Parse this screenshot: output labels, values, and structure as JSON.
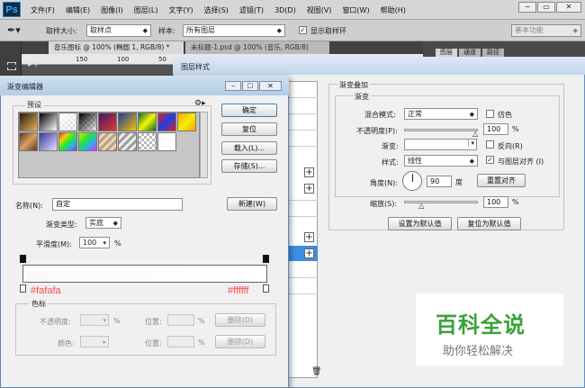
{
  "app": {
    "logo": "Ps"
  },
  "menubar": [
    "文件(F)",
    "编辑(E)",
    "图像(I)",
    "图层(L)",
    "文字(Y)",
    "选择(S)",
    "滤镜(T)",
    "3D(D)",
    "视图(V)",
    "窗口(W)",
    "帮助(H)"
  ],
  "options": {
    "sample_size_label": "取样大小:",
    "sample_size_value": "取样点",
    "sample_label": "样本:",
    "sample_value": "所有图层",
    "ring_label": "显示取样环",
    "workspace": "基本功能"
  },
  "doc_tabs": [
    "音乐图标 @ 100% (椭圆 1, RGB/8) *",
    "未标题-1.psd @ 100% (音乐, RGB/8)"
  ],
  "panel_tabs": [
    "图层",
    "通道",
    "路径"
  ],
  "ruler": [
    "150",
    "100",
    "50"
  ],
  "layer_style": {
    "title": "图层样式",
    "section": "渐变叠加",
    "subsection": "渐变",
    "blend_mode_label": "混合模式:",
    "blend_mode_value": "正常",
    "dither_label": "仿色",
    "opacity_label": "不透明度(P):",
    "opacity_value": "100",
    "gradient_label": "渐变:",
    "reverse_label": "反向(R)",
    "style_label": "样式:",
    "style_value": "线性",
    "align_label": "与图层对齐 (I)",
    "angle_label": "角度(N):",
    "angle_value": "90",
    "angle_unit": "度",
    "reset_align": "重置对齐",
    "scale_label": "缩放(S):",
    "scale_value": "100",
    "percent": "%",
    "set_default": "设置为默认值",
    "reset_default": "复位为默认值"
  },
  "gradient_editor": {
    "title": "渐变编辑器",
    "presets_label": "预设",
    "ok": "确定",
    "reset": "复位",
    "load": "载入(L)...",
    "save": "存储(S)...",
    "name_label": "名称(N):",
    "name_value": "自定",
    "new": "新建(W)",
    "type_label": "渐变类型:",
    "type_value": "实底",
    "smooth_label": "平滑度(M):",
    "smooth_value": "100",
    "percent": "%",
    "left_stop_color": "#fafafa",
    "right_stop_color": "#ffffff",
    "left_hex": "#fafafa",
    "right_hex": "#ffffff",
    "stops_group": "色标",
    "opacity_label": "不透明度:",
    "location_label": "位置:",
    "delete": "删除(D)",
    "color_label": "颜色:",
    "percent2": "%"
  },
  "watermark": {
    "title": "百科全说",
    "subtitle": "助你轻松解决"
  }
}
